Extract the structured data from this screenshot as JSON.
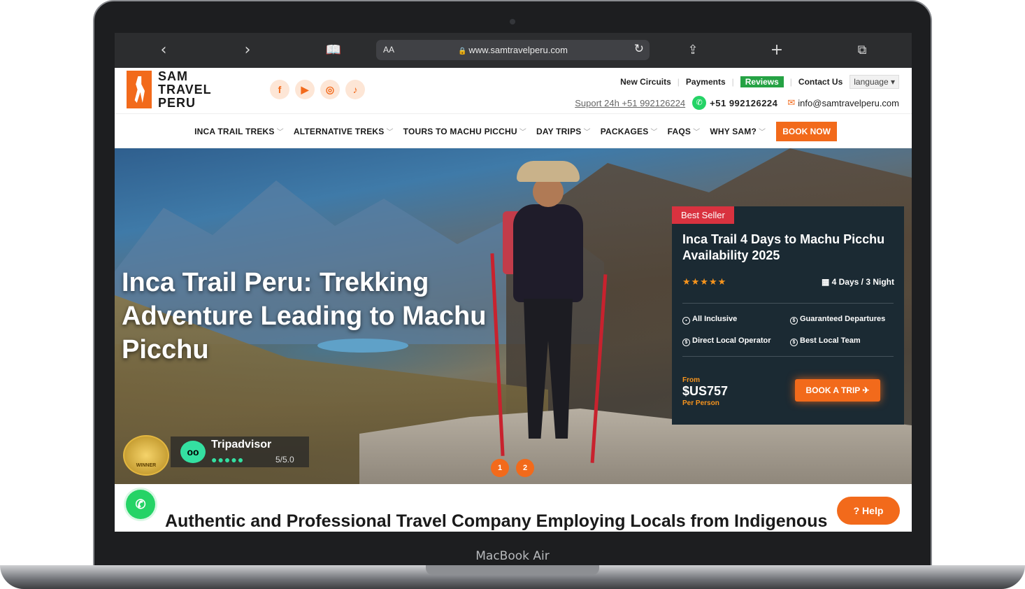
{
  "device": {
    "label": "MacBook Air"
  },
  "browser": {
    "aa": "AA",
    "url": "www.samtravelperu.com",
    "icons": [
      "chevron-left-icon",
      "chevron-right-icon",
      "book-icon",
      "lock-icon",
      "reload-icon",
      "share-icon",
      "plus-icon",
      "tabs-icon"
    ]
  },
  "brand": {
    "line1": "SAM",
    "line2": "TRAVEL",
    "line3": "PERU",
    "accent": "#f26a1b"
  },
  "social": {
    "facebook": "f",
    "youtube": "▶",
    "instagram": "◎",
    "tiktok": "♪"
  },
  "toplinks": {
    "new_circuits": "New Circuits",
    "payments": "Payments",
    "reviews": "Reviews",
    "contact": "Contact Us",
    "language": "language"
  },
  "contact": {
    "support": "Suport 24h +51 992126224",
    "whatsapp": "+51 992126224",
    "email": "info@samtravelperu.com"
  },
  "nav": {
    "items": [
      "INCA TRAIL TREKS",
      "ALTERNATIVE TREKS",
      "TOURS TO MACHU PICCHU",
      "DAY TRIPS",
      "PACKAGES",
      "FAQS",
      "WHY SAM?"
    ],
    "book_now": "BOOK NOW"
  },
  "hero": {
    "title": "Inca Trail Peru: Trekking Adventure Leading to Machu Picchu",
    "slides": [
      "1",
      "2"
    ]
  },
  "card": {
    "badge": "Best Seller",
    "title": "Inca Trail 4 Days to Machu Picchu Availability 2025",
    "stars": "★★★★★",
    "duration": "4 Days / 3 Night",
    "features": [
      "All Inclusive",
      "Guaranteed Departures",
      "Direct Local Operator",
      "Best Local Team"
    ],
    "from": "From",
    "price": "$US757",
    "per_person": "Per Person",
    "cta": "BOOK A TRIP ✈"
  },
  "tripadvisor": {
    "name": "Tripadvisor",
    "rating_dots": "●●●●●",
    "score": "5/5.0",
    "award_text": "WINNER"
  },
  "help": {
    "label": "? Help"
  },
  "section": {
    "title": "Authentic and Professional Travel Company Employing Locals from Indigenous"
  }
}
